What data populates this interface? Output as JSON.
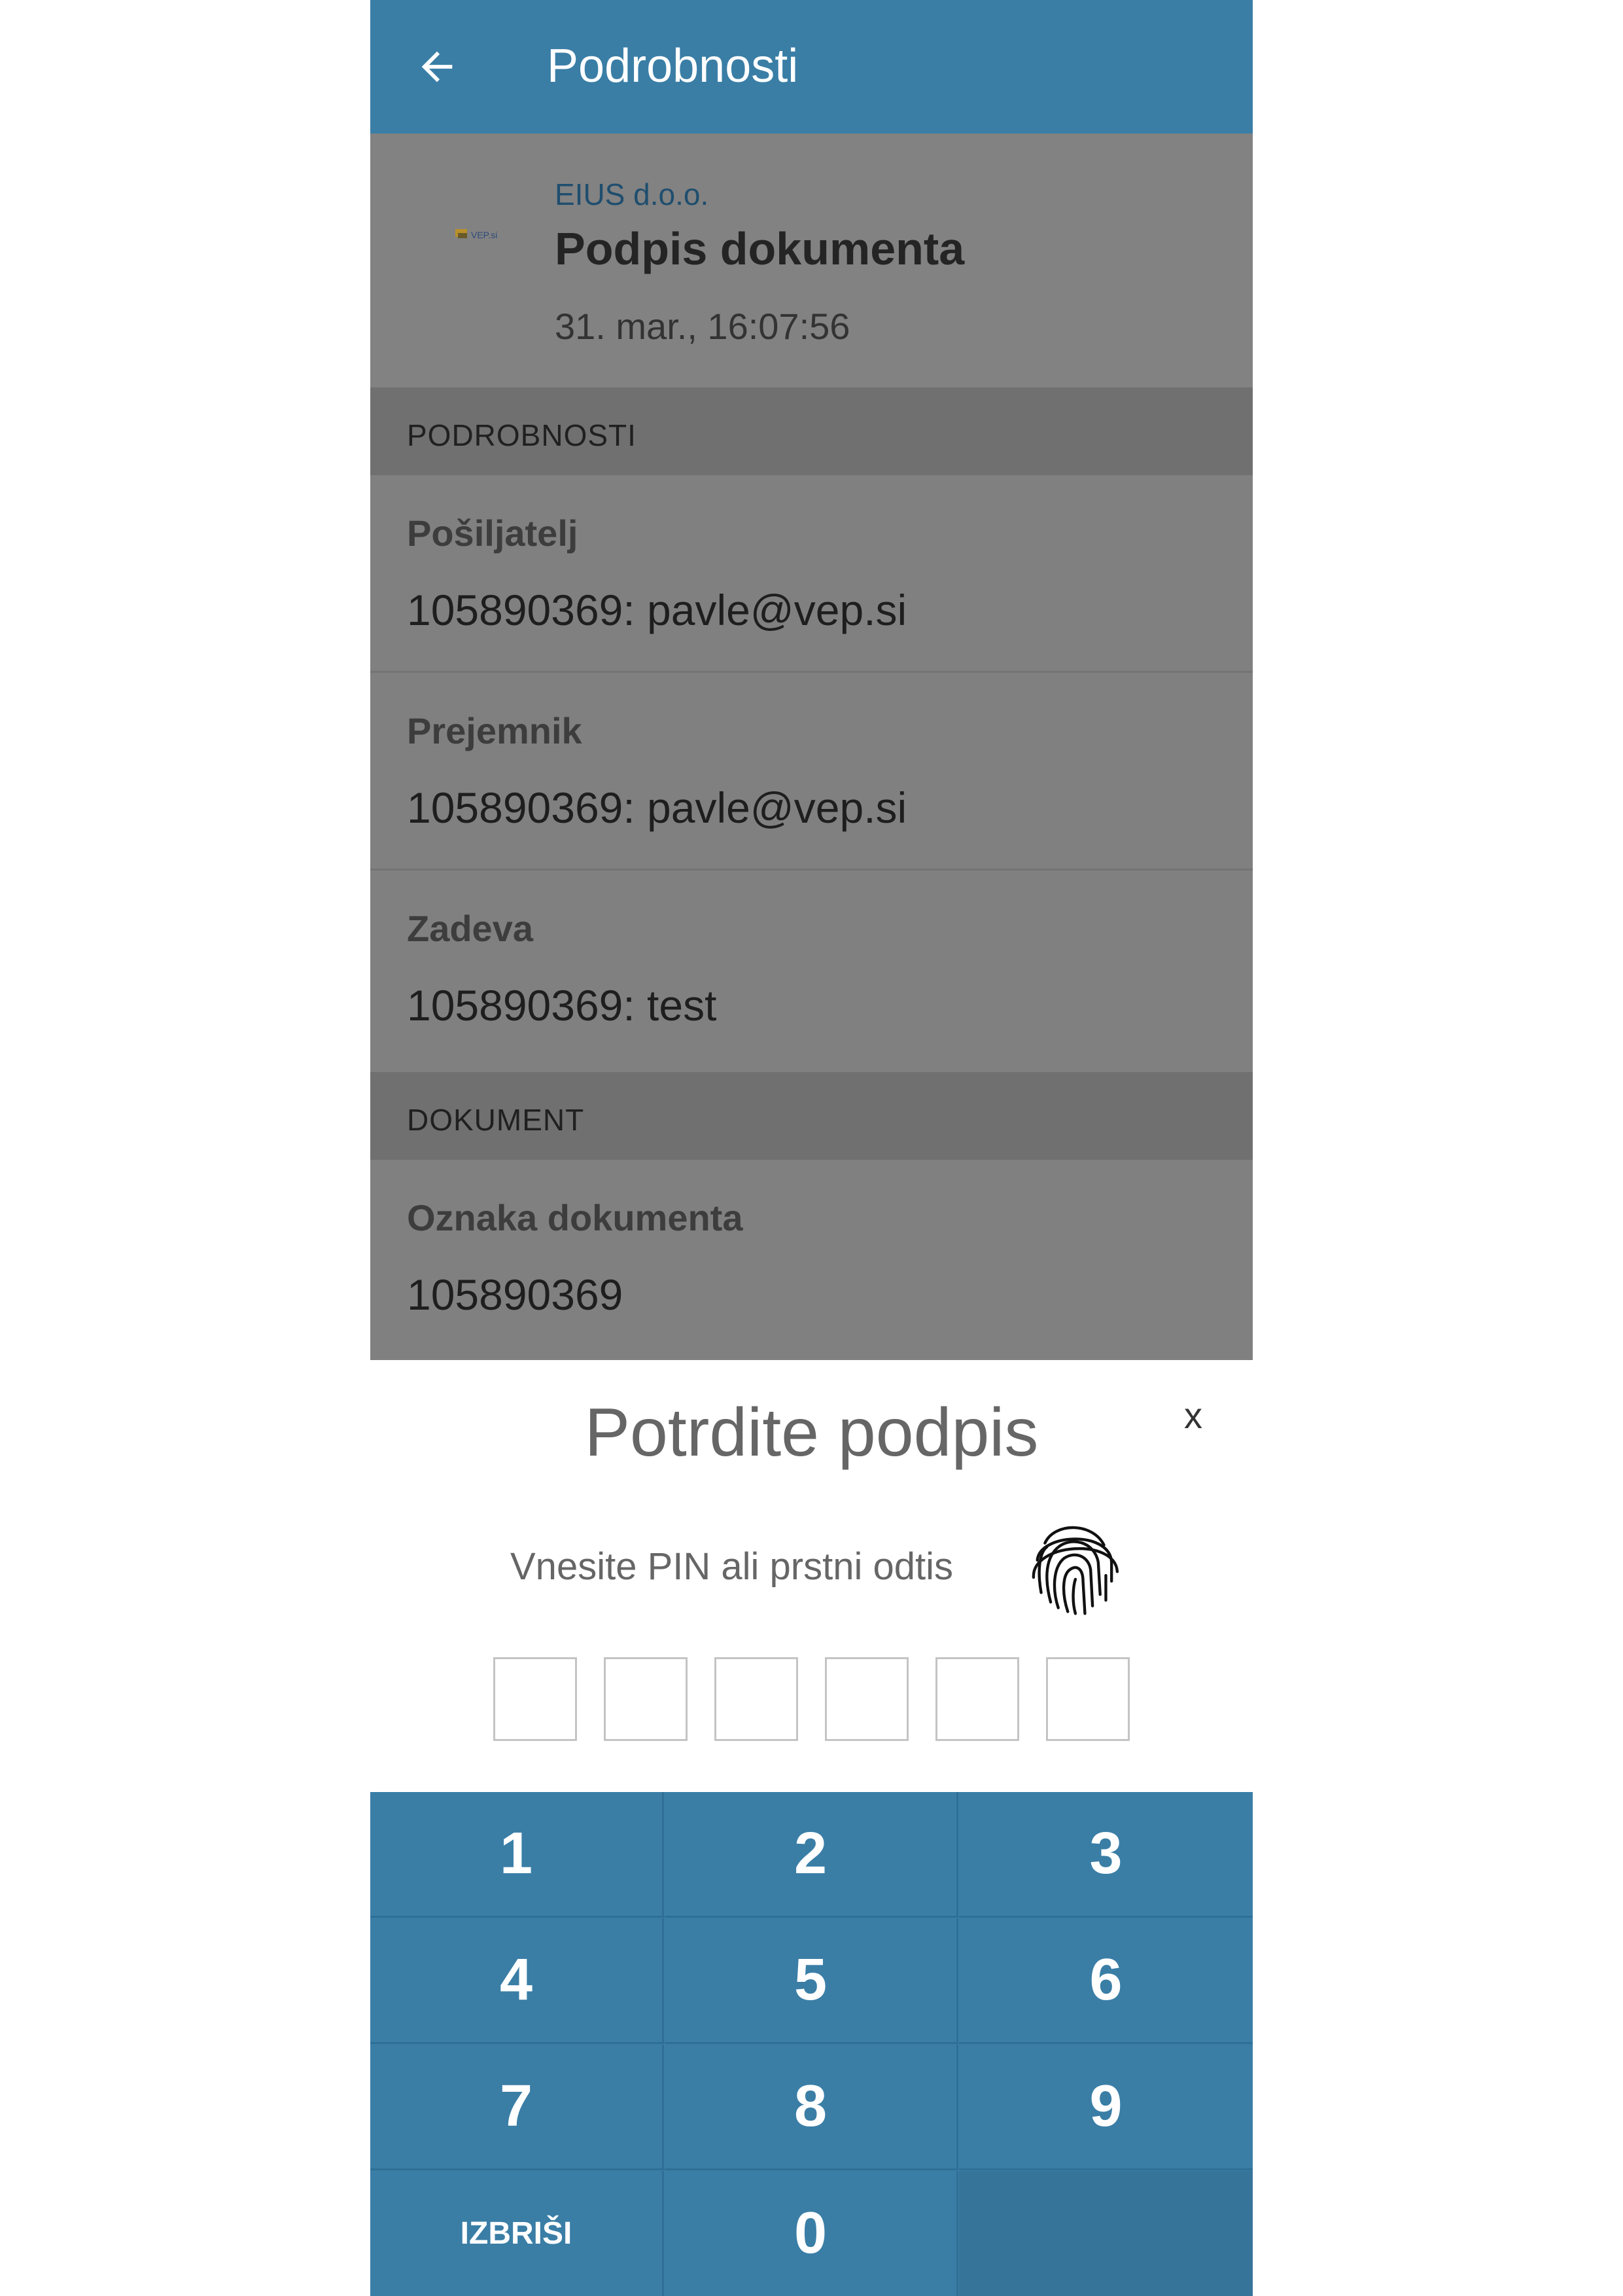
{
  "appbar": {
    "title": "Podrobnosti",
    "back_icon": "arrow-left-icon"
  },
  "header": {
    "logo_text": "VEP.si",
    "company": "EIUS d.o.o.",
    "title": "Podpis dokumenta",
    "date": "31. mar., 16:07:56"
  },
  "sections": {
    "details_title": "PODROBNOSTI",
    "document_title": "DOKUMENT"
  },
  "fields": {
    "sender_label": "Pošiljatelj",
    "sender_value": "105890369: pavle@vep.si",
    "recipient_label": "Prejemnik",
    "recipient_value": "105890369: pavle@vep.si",
    "subject_label": "Zadeva",
    "subject_value": "105890369: test",
    "doc_id_label": "Oznaka dokumenta",
    "doc_id_value": "105890369"
  },
  "confirm": {
    "heading": "Potrdite podpis",
    "close_label": "x",
    "hint": "Vnesite PIN ali prstni odtis",
    "fingerprint_icon": "fingerprint-icon",
    "pin_length": 6
  },
  "keypad": {
    "k1": "1",
    "k2": "2",
    "k3": "3",
    "k4": "4",
    "k5": "5",
    "k6": "6",
    "k7": "7",
    "k8": "8",
    "k9": "9",
    "delete": "IZBRIŠI",
    "k0": "0"
  },
  "colors": {
    "primary": "#3a7ea6",
    "overlay": "#808080"
  }
}
